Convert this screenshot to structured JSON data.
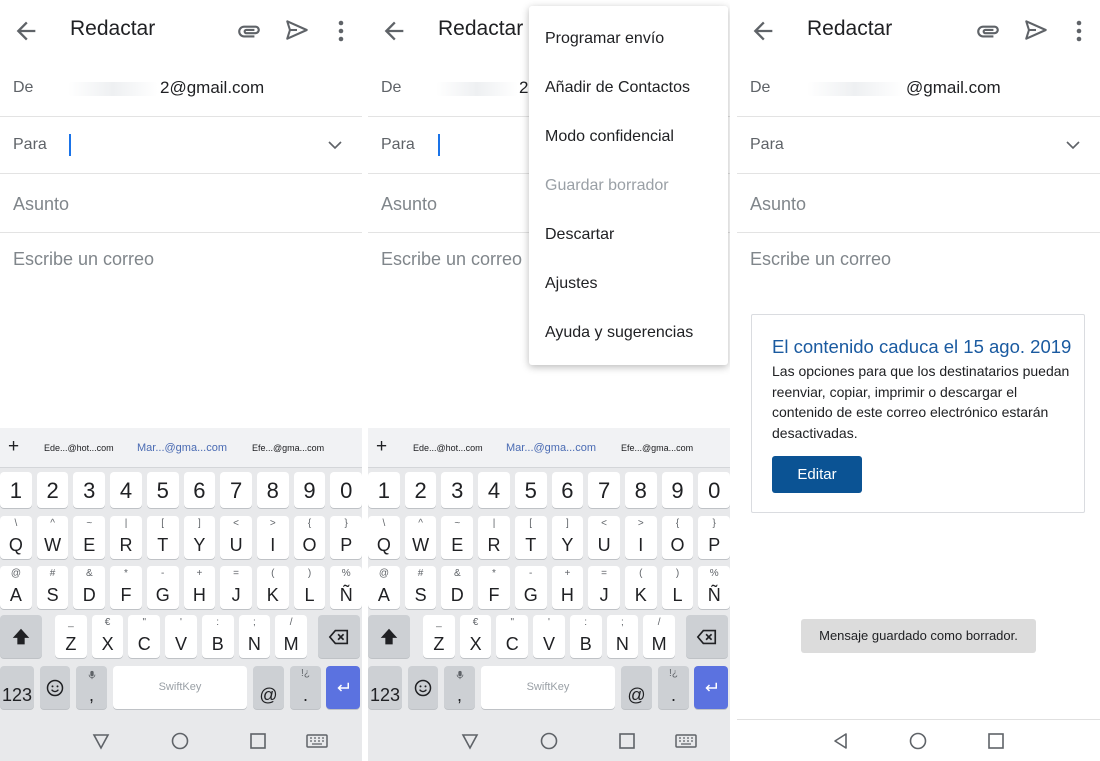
{
  "compose": {
    "title": "Redactar",
    "from_label": "De",
    "from_value_1": "2@gmail.com",
    "from_value_2": "2",
    "from_value_3": "@gmail.com",
    "to_label": "Para",
    "subject_placeholder": "Asunto",
    "body_placeholder": "Escribe un correo"
  },
  "keyboard": {
    "suggestions": [
      "Ede...@hot...com",
      "Mar...@gma...com",
      "Efe...@gma...com"
    ],
    "plus": "+",
    "number_row": [
      "1",
      "2",
      "3",
      "4",
      "5",
      "6",
      "7",
      "8",
      "9",
      "0"
    ],
    "row1": [
      {
        "p": "Q",
        "s": "\\"
      },
      {
        "p": "W",
        "s": "^"
      },
      {
        "p": "E",
        "s": "~"
      },
      {
        "p": "R",
        "s": "|"
      },
      {
        "p": "T",
        "s": "["
      },
      {
        "p": "Y",
        "s": "]"
      },
      {
        "p": "U",
        "s": "<"
      },
      {
        "p": "I",
        "s": ">"
      },
      {
        "p": "O",
        "s": "{"
      },
      {
        "p": "P",
        "s": "}"
      }
    ],
    "row2": [
      {
        "p": "A",
        "s": "@"
      },
      {
        "p": "S",
        "s": "#"
      },
      {
        "p": "D",
        "s": "&"
      },
      {
        "p": "F",
        "s": "*"
      },
      {
        "p": "G",
        "s": "-"
      },
      {
        "p": "H",
        "s": "+"
      },
      {
        "p": "J",
        "s": "="
      },
      {
        "p": "K",
        "s": "("
      },
      {
        "p": "L",
        "s": ")"
      },
      {
        "p": "Ñ",
        "s": "%"
      }
    ],
    "row3": [
      {
        "p": "Z",
        "s": "_"
      },
      {
        "p": "X",
        "s": "€"
      },
      {
        "p": "C",
        "s": "\""
      },
      {
        "p": "V",
        "s": "'"
      },
      {
        "p": "B",
        "s": ":"
      },
      {
        "p": "N",
        "s": ";"
      },
      {
        "p": "M",
        "s": "/"
      }
    ],
    "sym_key": "123",
    "comma_key": ",",
    "space_label": "SwiftKey",
    "at_key": "@",
    "period_key": ".",
    "period_sec": "!¿"
  },
  "menu": {
    "items": [
      {
        "label": "Programar envío",
        "enabled": true
      },
      {
        "label": "Añadir de Contactos",
        "enabled": true
      },
      {
        "label": "Modo confidencial",
        "enabled": true
      },
      {
        "label": "Guardar borrador",
        "enabled": false
      },
      {
        "label": "Descartar",
        "enabled": true
      },
      {
        "label": "Ajustes",
        "enabled": true
      },
      {
        "label": "Ayuda y sugerencias",
        "enabled": true
      }
    ]
  },
  "confidential_card": {
    "title": "El contenido caduca el 15 ago. 2019",
    "body": "Las opciones para que los destinatarios puedan reenviar, copiar, imprimir o descargar el contenido de este correo electrónico estarán desactivadas.",
    "button": "Editar"
  },
  "toast": "Mensaje guardado como borrador.",
  "colors": {
    "accent": "#1a73e8",
    "card_title": "#1a5aa0",
    "button": "#0b5394",
    "enter_key": "#5b72e0"
  },
  "icons": [
    "arrow-back-icon",
    "attach-icon",
    "send-icon",
    "more-vert-icon",
    "chevron-down-icon",
    "backspace-icon",
    "shift-icon",
    "emoji-icon",
    "mic-icon",
    "enter-icon",
    "nav-back-icon",
    "nav-home-icon",
    "nav-recents-icon",
    "keyboard-icon"
  ]
}
